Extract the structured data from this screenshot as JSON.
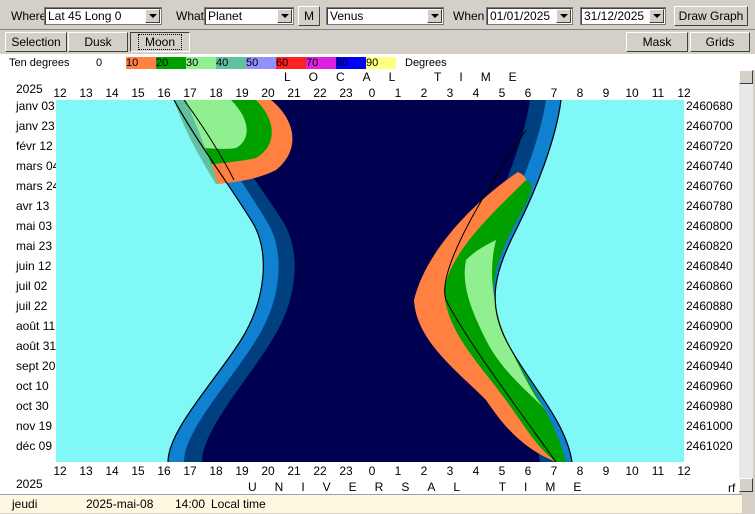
{
  "toolbar": {
    "where_label": "Where",
    "where_value": "Lat 45 Long 0",
    "what_label": "What",
    "what_value": "Planet",
    "m_button": "M",
    "planet_value": "Venus",
    "when_label": "When",
    "date_from": "01/01/2025",
    "date_to": "31/12/2025",
    "draw_button": "Draw Graph"
  },
  "toolbar2": {
    "selection": "Selection",
    "dusk": "Dusk",
    "moon": "Moon",
    "mask": "Mask",
    "grids": "Grids"
  },
  "legend": {
    "title": "Ten degrees",
    "unit": "Degrees",
    "items": [
      {
        "label": "0",
        "color": "#ffffff"
      },
      {
        "label": "10",
        "color": "#ff8040"
      },
      {
        "label": "20",
        "color": "#00a000"
      },
      {
        "label": "30",
        "color": "#90f090"
      },
      {
        "label": "40",
        "color": "#60c0a0"
      },
      {
        "label": "50",
        "color": "#9090ff"
      },
      {
        "label": "60",
        "color": "#ff2020"
      },
      {
        "label": "70",
        "color": "#e020e0"
      },
      {
        "label": "80",
        "color": "#0000ff"
      },
      {
        "label": "90",
        "color": "#ffff80"
      }
    ]
  },
  "chart_data": {
    "type": "heatmap",
    "year": "2025",
    "top_axis_title": "LOCAL TIME",
    "bottom_axis_title": "UNIVERSAL TIME",
    "x_ticks": [
      "12",
      "13",
      "14",
      "15",
      "16",
      "17",
      "18",
      "19",
      "20",
      "21",
      "22",
      "23",
      "0",
      "1",
      "2",
      "3",
      "4",
      "5",
      "6",
      "7",
      "8",
      "9",
      "10",
      "11",
      "12"
    ],
    "y_labels_left": [
      "janv 03",
      "janv 23",
      "févr 12",
      "mars 04",
      "mars 24",
      "avr 13",
      "mai 03",
      "mai 23",
      "juin 12",
      "juil 02",
      "juil 22",
      "août 11",
      "août 31",
      "sept 20",
      "oct 10",
      "oct 30",
      "nov 19",
      "déc 09"
    ],
    "y_labels_right": [
      "2460680",
      "2460700",
      "2460720",
      "2460740",
      "2460760",
      "2460780",
      "2460800",
      "2460820",
      "2460840",
      "2460860",
      "2460880",
      "2460900",
      "2460920",
      "2460940",
      "2460960",
      "2460980",
      "2461000",
      "2461020"
    ],
    "colors": {
      "day": "#80f8f8",
      "night": "#000050",
      "civil": "#0060b0",
      "nautical": "#1080d0",
      "astro": "#004080"
    },
    "evening_twilight": [
      {
        "date": "janv 03",
        "sunset_h": 16.7
      },
      {
        "date": "mars 24",
        "sunset_h": 18.3
      },
      {
        "date": "juin 12",
        "sunset_h": 20.0
      },
      {
        "date": "juil 22",
        "sunset_h": 19.9
      },
      {
        "date": "oct 30",
        "sunset_h": 17.3
      },
      {
        "date": "déc 09",
        "sunset_h": 16.4
      }
    ],
    "morning_twilight": [
      {
        "date": "janv 03",
        "sunrise_h": 7.7
      },
      {
        "date": "mars 24",
        "sunrise_h": 6.6
      },
      {
        "date": "juin 12",
        "sunrise_h": 4.5
      },
      {
        "date": "juil 22",
        "sunrise_h": 4.8
      },
      {
        "date": "oct 30",
        "sunrise_h": 7.2
      },
      {
        "date": "déc 09",
        "sunrise_h": 7.7
      }
    ],
    "venus_evening": [
      {
        "date": "janv 03",
        "altitude_band": "30"
      },
      {
        "date": "févr 12",
        "altitude_band": "20"
      },
      {
        "date": "mars 04",
        "altitude_band": "10"
      }
    ],
    "venus_morning": [
      {
        "date": "juin 12",
        "altitude_band": "20"
      },
      {
        "date": "juil 22",
        "altitude_band": "30"
      },
      {
        "date": "oct 10",
        "altitude_band": "20"
      },
      {
        "date": "déc 09",
        "altitude_band": "10"
      }
    ]
  },
  "status": {
    "day": "jeudi",
    "date": "2025-mai-08",
    "time": "14:00",
    "mode": "Local time",
    "corner": "rf"
  }
}
